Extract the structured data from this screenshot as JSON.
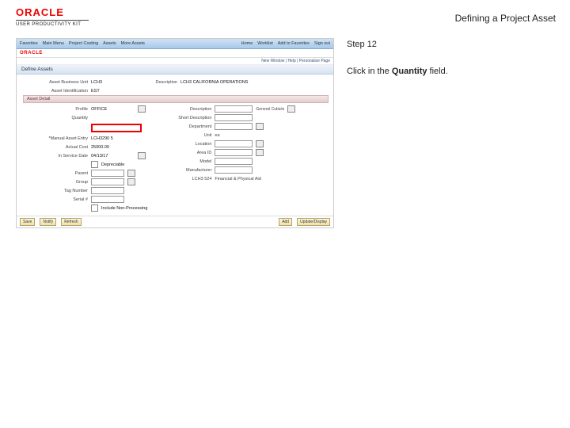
{
  "header": {
    "brand": "ORACLE",
    "subbrand": "USER PRODUCTIVITY KIT",
    "doc_title": "Defining a Project Asset"
  },
  "instruction": {
    "step_label": "Step 12",
    "line_prefix": "Click in the ",
    "target_field": "Quantity",
    "line_suffix": " field."
  },
  "app": {
    "topnav": {
      "items": [
        "Favorites",
        "Main Menu",
        "Project Costing",
        "Assets",
        "More Assets"
      ],
      "right": [
        "Home",
        "Worklist",
        "Add to Favorites",
        "Sign out"
      ]
    },
    "brand": "ORACLE",
    "crumbs": "New Window | Help | Personalize Page",
    "page_title": "Define Assets",
    "form_top": {
      "bu_label": "Asset Business Unit",
      "bu_value": "LCH3",
      "desc_label": "Description",
      "desc_value": "LCH3 CALIFORNIA OPERATIONS",
      "aid_label": "Asset Identification",
      "aid_value": "EST"
    },
    "section": "Asset Detail",
    "left": [
      {
        "l": "Profile",
        "v": "OFFICE"
      },
      {
        "l": "Quantity",
        "v": ""
      },
      {
        "l": "*Manual Asset Entry",
        "v": "LCH3290   5"
      },
      {
        "l": "Actual Cost",
        "v": "25000.00"
      },
      {
        "l": "In Service Date",
        "v": "04/13/17"
      },
      {
        "l": "",
        "v": "Depreciable"
      },
      {
        "l": "Parent",
        "v": ""
      },
      {
        "l": "Group",
        "v": ""
      },
      {
        "l": "Tag Number",
        "v": ""
      },
      {
        "l": "Serial #",
        "v": ""
      }
    ],
    "right": [
      {
        "l": "Description",
        "v": "General Cubicle"
      },
      {
        "l": "Short Description",
        "v": ""
      },
      {
        "l": "Department",
        "v": ""
      },
      {
        "l": "Unit",
        "v": "ea"
      },
      {
        "l": "Location",
        "v": ""
      },
      {
        "l": "Area ID",
        "v": ""
      },
      {
        "l": "Model",
        "v": ""
      },
      {
        "l": "Manufacturer",
        "v": ""
      },
      {
        "l": "LCH3 524",
        "v": "Financial & Physical Aid"
      }
    ],
    "checkbox_label": "Include Non-Processing",
    "footer": {
      "save": "Save",
      "notify": "Notify",
      "refresh": "Refresh",
      "add": "Add",
      "update": "Update/Display"
    }
  }
}
